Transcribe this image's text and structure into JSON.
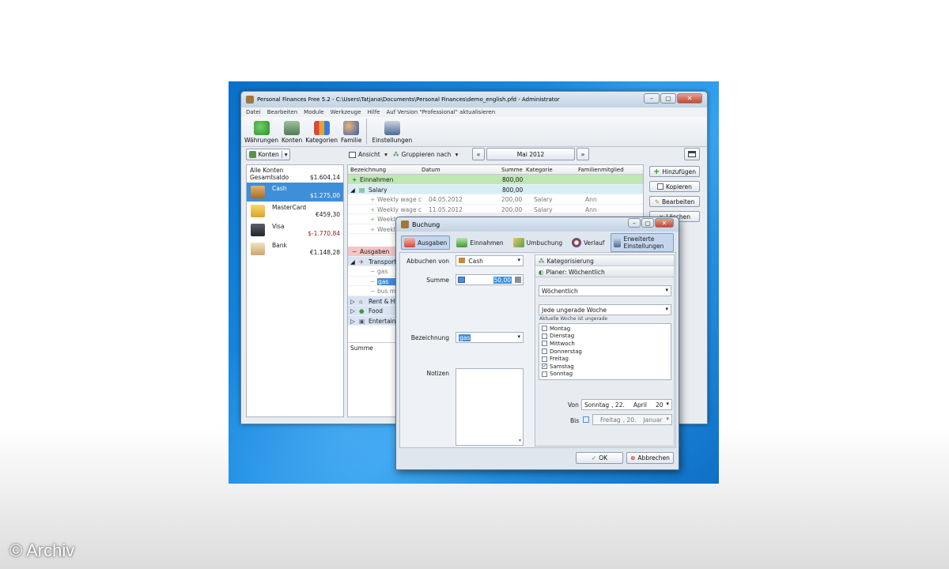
{
  "main": {
    "title": "Personal Finances Free 5.2 - C:\\Users\\Tatjana\\Documents\\Personal Finances\\demo_english.pfd - Administrator",
    "menu": [
      "Datei",
      "Bearbeiten",
      "Module",
      "Werkzeuge",
      "Hilfe",
      "Auf Version \"Professional\" aktualisieren"
    ],
    "toolbar": {
      "waehrungen": "Währungen",
      "konten": "Konten",
      "kategorien": "Kategorien",
      "familie": "Familie",
      "einstellungen": "Einstellungen"
    },
    "konten_button": "Konten",
    "ansicht": "Ansicht",
    "gruppieren": "Gruppieren nach",
    "month": "Mai 2012",
    "accounts": {
      "all_label": "Alle Konten",
      "total_label": "Gesamtsaldo",
      "total_value": "$1.604,14",
      "items": [
        {
          "name": "Cash",
          "balance": "$1.275,00"
        },
        {
          "name": "MasterCard",
          "balance": "€459,30"
        },
        {
          "name": "Visa",
          "balance": "$-1.770,84"
        },
        {
          "name": "Bank",
          "balance": "€1.148,28"
        }
      ]
    },
    "grid": {
      "headers": {
        "bezeichnung": "Bezeichnung",
        "datum": "Datum",
        "summe": "Summe",
        "kategorie": "Kategorie",
        "familienmitglied": "Familienmitglied"
      },
      "einnahmen": {
        "label": "Einnahmen",
        "sum": "800,00"
      },
      "salary": {
        "label": "Salary",
        "sum": "800,00"
      },
      "wage_rows": [
        {
          "label": "Weekly wage c",
          "date": "04.05.2012",
          "sum": "200,00",
          "cat": "Salary",
          "member": "Ann"
        },
        {
          "label": "Weekly wage c",
          "date": "11.05.2012",
          "sum": "200,00",
          "cat": "Salary",
          "member": "Ann"
        },
        {
          "label": "Weekly"
        },
        {
          "label": "Weekly"
        }
      ],
      "ausgaben": "Ausgaben",
      "transport": "Transport",
      "transport_rows": [
        "gas",
        "gas",
        "bus mo"
      ],
      "groups": [
        "Rent & Ho",
        "Food",
        "Entertainm"
      ],
      "summe_label": "Summe"
    },
    "buttons": {
      "add": "Hinzufügen",
      "copy": "Kopieren",
      "edit": "Bearbeiten",
      "delete": "Löschen"
    }
  },
  "dialog": {
    "title": "Buchung",
    "tabs": {
      "ausgaben": "Ausgaben",
      "einnahmen": "Einnahmen",
      "umbuchung": "Umbuchung",
      "verlauf": "Verlauf",
      "erweitert": "Erweiterte Einstellungen"
    },
    "abbuchen_label": "Abbuchen von",
    "abbuchen_value": "Cash",
    "summe_label": "Summe",
    "summe_value": "50,00",
    "bezeichnung_label": "Bezeichnung",
    "bezeichnung_value": "gas",
    "notizen_label": "Notizen",
    "kategorisierung": "Kategorisierung",
    "planer": "Planer: Wöchentlich",
    "frequency": "Wöchentlich",
    "week_rule": "Jede ungerade Woche",
    "week_hint": "Aktuelle Woche ist ungerade",
    "days": [
      {
        "name": "Montag",
        "checked": false
      },
      {
        "name": "Dienstag",
        "checked": false
      },
      {
        "name": "Mittwoch",
        "checked": false
      },
      {
        "name": "Donnerstag",
        "checked": false
      },
      {
        "name": "Freitag",
        "checked": false
      },
      {
        "name": "Samstag",
        "checked": true
      },
      {
        "name": "Sonntag",
        "checked": false
      }
    ],
    "von_label": "Von",
    "von_weekday": "Sonntag",
    "von_day": ", 22.",
    "von_month": "April",
    "von_year": "20",
    "bis_label": "Bis",
    "bis_weekday": "Freitag",
    "bis_day": ", 20.",
    "bis_month": "Januar",
    "ok": "OK",
    "cancel": "Abbrechen"
  },
  "watermark": "© Archiv",
  "colors": {
    "desktop": "#1a8be0",
    "accent": "#3e8fd8",
    "income_row": "#bfe7b4",
    "expense_row": "#f3c6c6",
    "negative": "#8b1a1a"
  }
}
